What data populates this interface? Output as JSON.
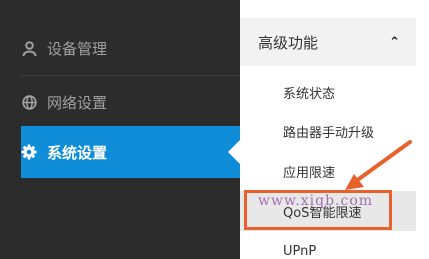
{
  "sidebar": {
    "items": [
      {
        "label": "设备管理",
        "icon": "user-icon"
      },
      {
        "label": "网络设置",
        "icon": "globe-icon"
      },
      {
        "label": "系统设置",
        "icon": "gear-icon",
        "active": true
      }
    ]
  },
  "submenu": {
    "header": "高级功能",
    "items": [
      {
        "label": "系统状态"
      },
      {
        "label": "路由器手动升级"
      },
      {
        "label": "应用限速"
      },
      {
        "label": "QoS智能限速",
        "highlighted": true
      },
      {
        "label": "UPnP"
      }
    ]
  },
  "watermark": "www.xiqb.com",
  "colors": {
    "sidebar_bg": "#2c2c2c",
    "active_blue": "#0f8dd9",
    "annotation_orange": "#e8602c"
  }
}
